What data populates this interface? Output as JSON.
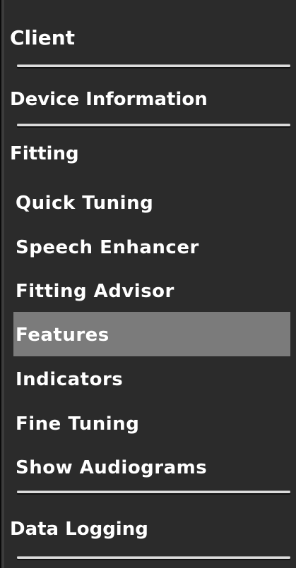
{
  "nav": {
    "client": "Client",
    "device_information": "Device Information",
    "fitting": "Fitting",
    "fitting_items": {
      "quick_tuning": "Quick Tuning",
      "speech_enhancer": "Speech Enhancer",
      "fitting_advisor": "Fitting Advisor",
      "features": "Features",
      "indicators": "Indicators",
      "fine_tuning": "Fine Tuning",
      "show_audiograms": "Show Audiograms"
    },
    "data_logging": "Data Logging",
    "selected": "Features"
  },
  "colors": {
    "background": "#2b2b2b",
    "selected_background": "#7b7b7b",
    "text": "#ffffff",
    "separator": "#dcdcdc"
  }
}
